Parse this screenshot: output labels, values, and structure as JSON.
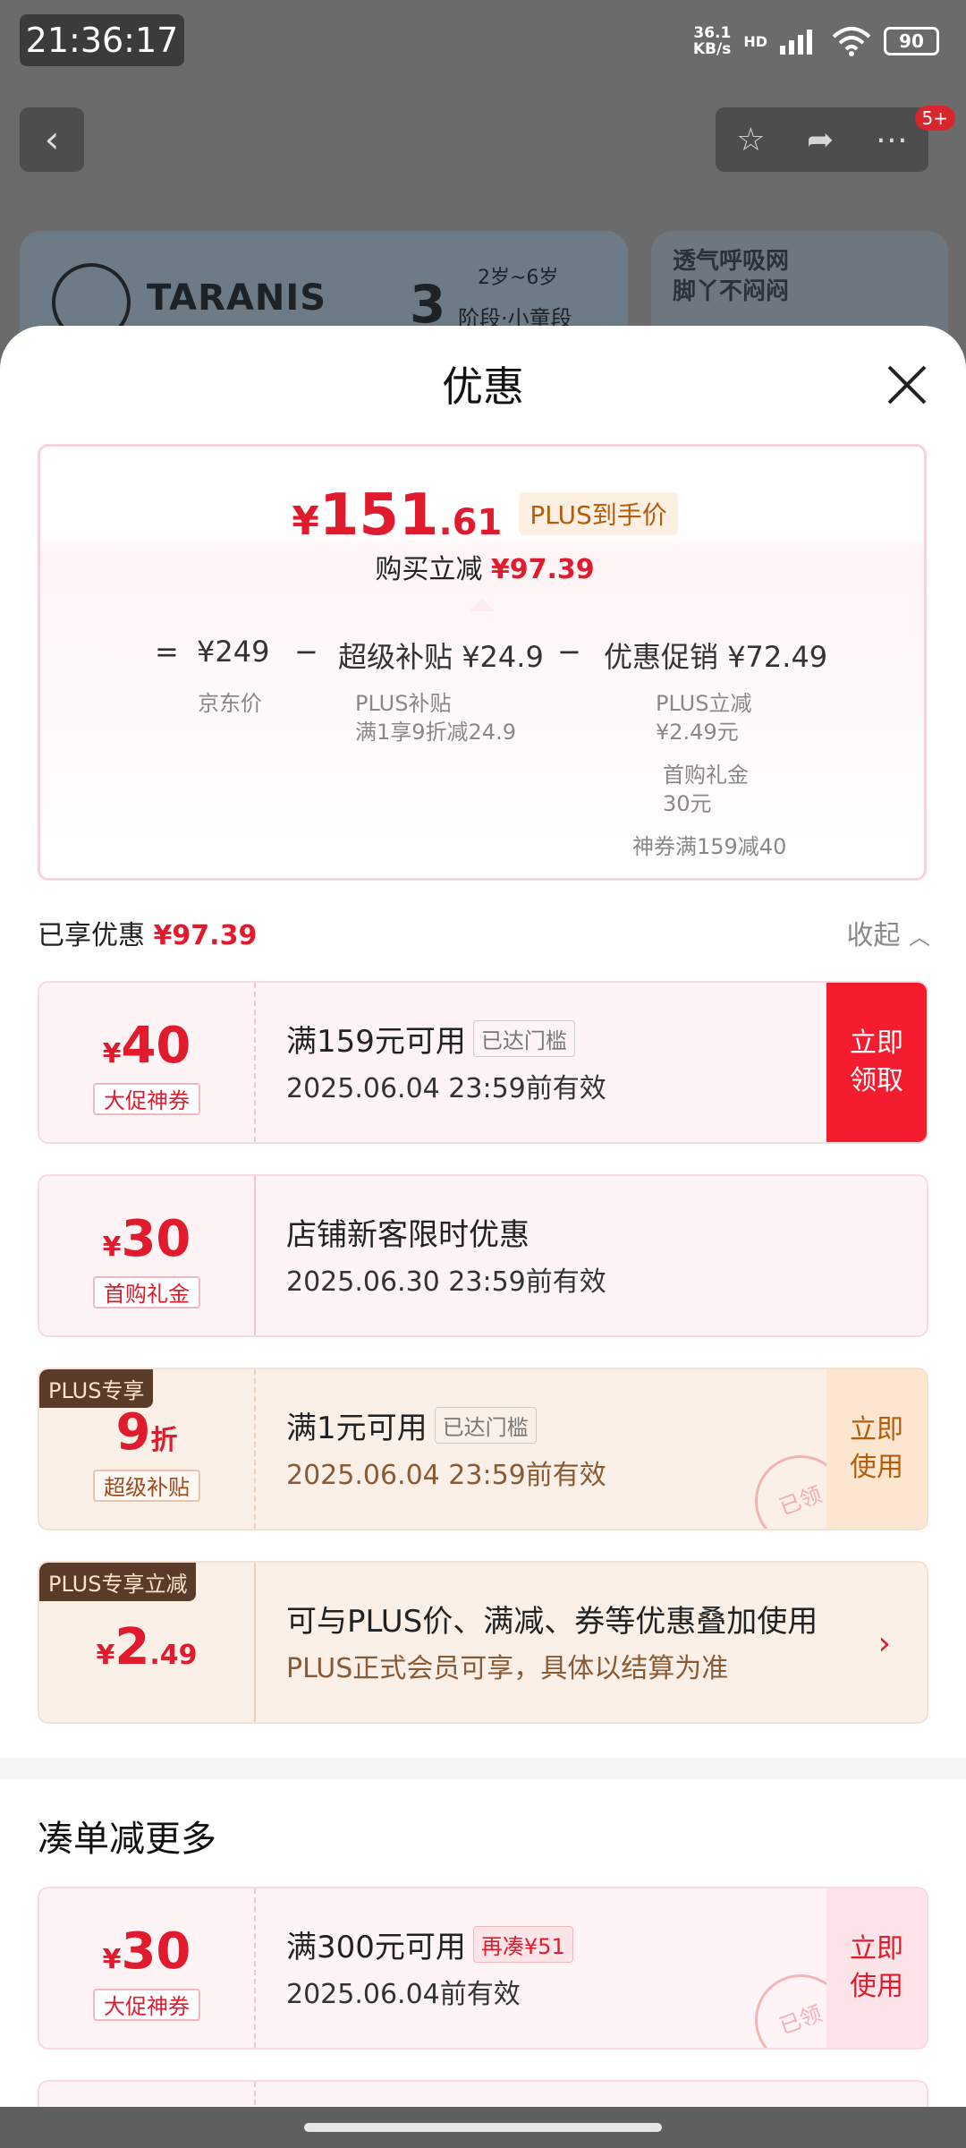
{
  "status_bar": {
    "time": "21:36:17",
    "net_speed_value": "36.1",
    "net_speed_unit": "KB/s",
    "network": "HD",
    "battery": "90"
  },
  "top_nav": {
    "cart_badge": "5+"
  },
  "background_banners": {
    "brand": "TARANIS",
    "stage_age": "2岁~6岁",
    "stage_num": "3",
    "stage_label": "阶段·小童段",
    "side_text_1": "透气呼吸网",
    "side_text_2": "脚丫不闷闷"
  },
  "sheet": {
    "title": "优惠"
  },
  "price_summary": {
    "yen": "¥",
    "price_int": "151",
    "price_dec": ".61",
    "plus_tag": "PLUS到手价",
    "instant_off_label": "购买立减",
    "instant_off_value": "¥97.39",
    "eq": "=",
    "minus1": "−",
    "minus2": "−",
    "jd_price": "¥249",
    "jd_price_label": "京东价",
    "subsidy_label": "超级补贴",
    "subsidy_value": "¥24.9",
    "subsidy_detail_1": "PLUS补贴",
    "subsidy_detail_2": "满1享9折减24.9",
    "promo_label": "优惠促销",
    "promo_value": "¥72.49",
    "promo_detail_1": "PLUS立减",
    "promo_detail_2": "¥2.49元",
    "promo_detail_3": "首购礼金",
    "promo_detail_4": "30元",
    "promo_detail_5": "神券满159减40"
  },
  "enjoyed": {
    "label": "已享优惠",
    "value": "¥97.39",
    "collapse_label": "收起"
  },
  "coupons": [
    {
      "yen": "¥",
      "amount": "40",
      "tag": "大促神券",
      "title": "满159元可用",
      "gate": "已达门槛",
      "date": "2025.06.04 23:59前有效",
      "action": "立即领取"
    },
    {
      "yen": "¥",
      "amount": "30",
      "tag": "首购礼金",
      "title": "店铺新客限时优惠",
      "date": "2025.06.30 23:59前有效"
    },
    {
      "corner": "PLUS专享",
      "amount": "9",
      "unit": "折",
      "tag": "超级补贴",
      "title": "满1元可用",
      "gate": "已达门槛",
      "date": "2025.06.04 23:59前有效",
      "action": "立即使用",
      "stamp": "已领"
    },
    {
      "corner": "PLUS专享立减",
      "yen": "¥",
      "amount": "2",
      "decimal": ".49",
      "title": "可与PLUS价、满减、券等优惠叠加使用",
      "date": "PLUS正式会员可享，具体以结算为准"
    }
  ],
  "more_section": {
    "title": "凑单减更多",
    "coupon": {
      "yen": "¥",
      "amount": "30",
      "tag": "大促神券",
      "title": "满300元可用",
      "gate": "再凑¥51",
      "date": "2025.06.04前有效",
      "action": "立即使用",
      "stamp": "已领"
    }
  },
  "colors": {
    "accent_red": "#e11b2e",
    "plus_brown": "#5a3b2a",
    "plus_orange": "#b45d0c"
  }
}
